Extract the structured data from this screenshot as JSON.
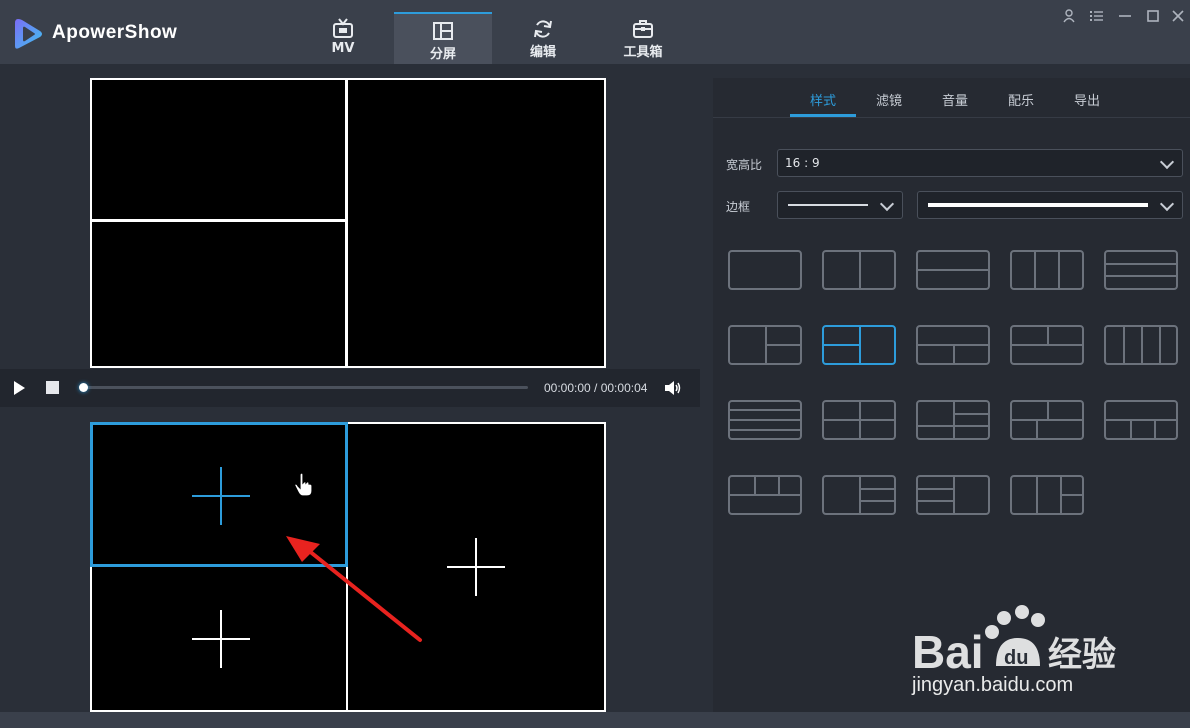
{
  "app": {
    "name": "ApowerShow"
  },
  "nav": {
    "tabs": [
      {
        "label": "MV",
        "icon": "tv-icon"
      },
      {
        "label": "分屏",
        "icon": "split-screen-icon",
        "active": true
      },
      {
        "label": "编辑",
        "icon": "refresh-icon"
      },
      {
        "label": "工具箱",
        "icon": "toolbox-icon"
      }
    ]
  },
  "window_controls": [
    "user-icon",
    "menu-icon",
    "minimize-icon",
    "maximize-icon",
    "close-icon"
  ],
  "player": {
    "time": "00:00:00 / 00:00:04",
    "progress": 0.0
  },
  "right_panel": {
    "tabs": [
      "样式",
      "滤镜",
      "音量",
      "配乐",
      "导出"
    ],
    "active_tab": "样式",
    "aspect_label": "宽高比",
    "aspect_value": "16 : 9",
    "border_label": "边框"
  },
  "layouts": {
    "count": 19,
    "selected_index": 6
  },
  "watermark": {
    "brand": "Bai 经验",
    "url": "jingyan.baidu.com"
  },
  "colors": {
    "accent": "#2d9cdb",
    "annotation_arrow": "#e8231f"
  }
}
